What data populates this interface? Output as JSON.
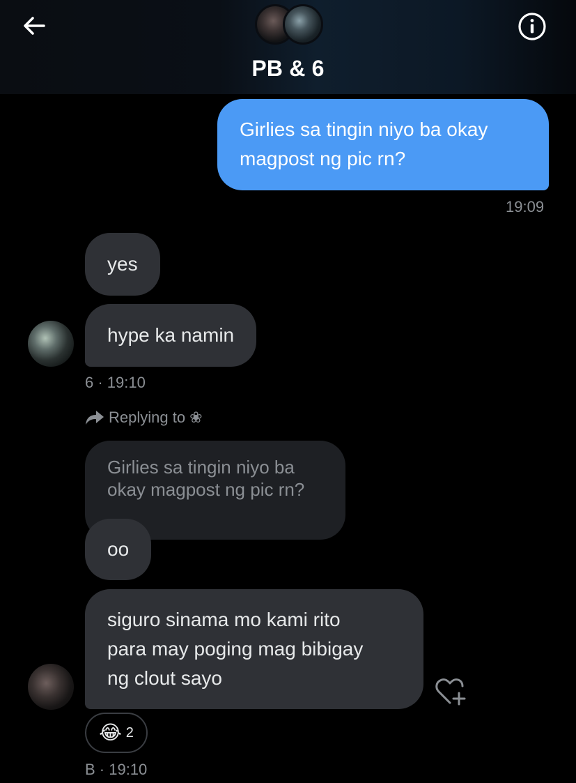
{
  "header": {
    "title": "PB & 6",
    "back_icon": "back-arrow-icon",
    "info_icon": "info-icon"
  },
  "messages": [
    {
      "text_lines": [
        "Girlies sa tingin niyo ba okay",
        "magpost ng pic rn?"
      ],
      "time": "19:09",
      "direction": "outgoing"
    },
    {
      "text": "yes",
      "direction": "incoming"
    },
    {
      "text": "hype ka namin",
      "meta": "6 · 19:10",
      "direction": "incoming"
    },
    {
      "reply_label": "Replying to ❀",
      "quoted_lines": [
        "Girlies sa tingin niyo ba",
        "okay magpost ng pic rn?"
      ],
      "text": "oo",
      "direction": "incoming"
    },
    {
      "text_lines": [
        "siguro sinama mo kami rito",
        "para may poging mag bibigay",
        "ng clout sayo"
      ],
      "meta": "B · 19:10",
      "direction": "incoming",
      "reaction": {
        "emoji": "😂",
        "count": "2"
      }
    }
  ],
  "colors": {
    "outgoing_bubble": "#4b9af5",
    "incoming_bubble": "#2f3136",
    "quoted_bubble": "#1e2024",
    "meta_text": "#8b8f94",
    "background": "#000000"
  }
}
